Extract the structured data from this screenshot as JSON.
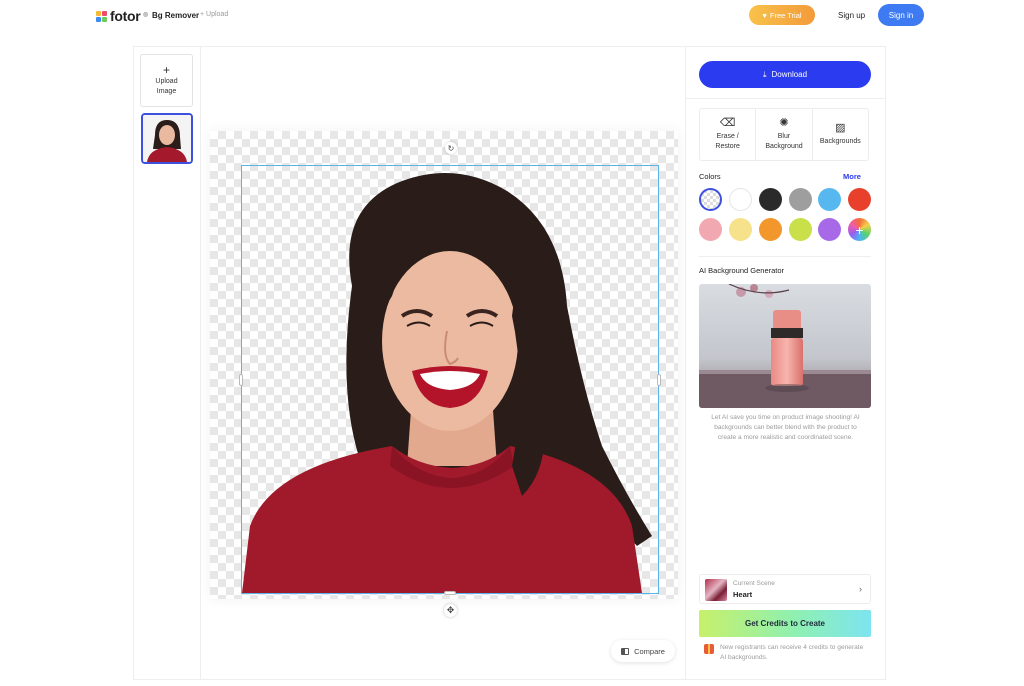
{
  "header": {
    "logo_text": "fotor",
    "logo_sup": "®",
    "tool_title": "Bg Remover",
    "crumb": "+ Upload",
    "free_trial": "Free Trial",
    "sign_up": "Sign up",
    "sign_in": "Sign in"
  },
  "left": {
    "upload_plus": "+",
    "upload_label_1": "Upload",
    "upload_label_2": "Image"
  },
  "canvas": {
    "compare_label": "Compare"
  },
  "panel": {
    "download_label": "Download",
    "tools": [
      {
        "icon": "eraser-icon",
        "label_1": "Erase /",
        "label_2": "Restore"
      },
      {
        "icon": "blur-icon",
        "label_1": "Blur",
        "label_2": "Background"
      },
      {
        "icon": "backgrounds-icon",
        "label_1": "Backgrounds",
        "label_2": ""
      }
    ],
    "colors_label": "Colors",
    "colors_more": "More",
    "colors": [
      "transparent",
      "#ffffff",
      "#2a2a2a",
      "#9e9e9e",
      "#56b8ee",
      "#e8402b",
      "#f2a8b0",
      "#f6e28a",
      "#f2972c",
      "#c9e04a",
      "#a869e8",
      "gradient"
    ],
    "ai_title": "AI Background Generator",
    "ai_desc": "Let AI save you time on product image shooting! AI backgrounds can better blend with the product to create a more realistic and coordinated scene.",
    "scene_label": "Current Scene",
    "scene_name": "Heart",
    "credits_label": "Get Credits to Create",
    "note": "New registrants can receive 4 credits to generate AI backgrounds."
  },
  "colors": {
    "accent": "#2b3bef",
    "selection": "#5ab4e8",
    "brand_orange": "#f39a3a"
  }
}
